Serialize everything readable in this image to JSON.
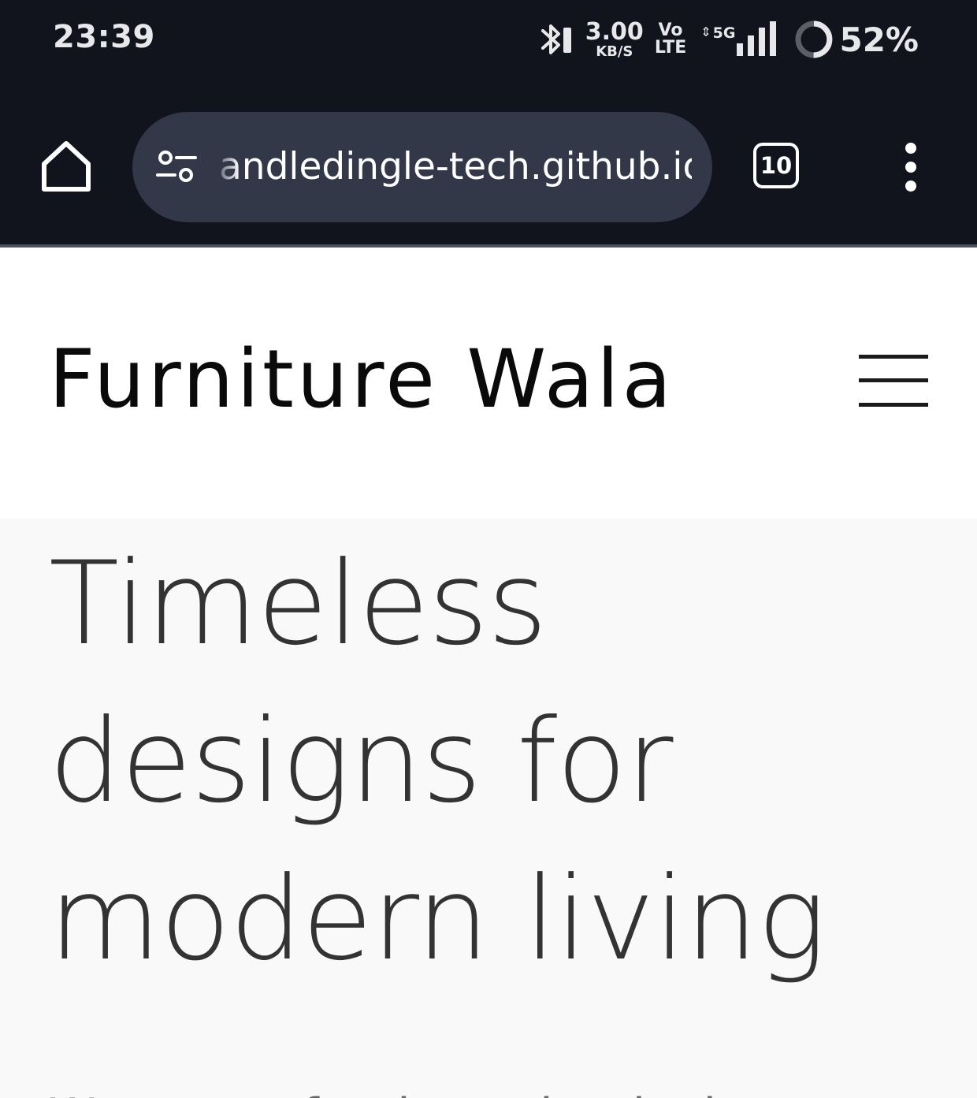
{
  "status_bar": {
    "time": "23:39",
    "speed_value": "3.00",
    "speed_unit": "KB/S",
    "volte_top": "Vo",
    "volte_bottom": "LTE",
    "network": "5G",
    "battery_percent": "52%",
    "icons": [
      "bluetooth-icon",
      "signal-icon",
      "battery-icon"
    ]
  },
  "browser": {
    "url": "andledingle-tech.github.io",
    "tab_count": "10",
    "icons": [
      "home-icon",
      "tune-icon",
      "tabs-icon",
      "more-vert-icon"
    ]
  },
  "site": {
    "title": "Furniture Wala",
    "menu_icon": "hamburger-icon"
  },
  "hero": {
    "title": "Timeless designs for modern living",
    "subtitle": "We create furniture that looks"
  },
  "colors": {
    "chrome_bg": "#11141c",
    "omnibox_bg": "#323848",
    "hero_bg": "#f9f9f9",
    "hero_text": "#333333"
  }
}
